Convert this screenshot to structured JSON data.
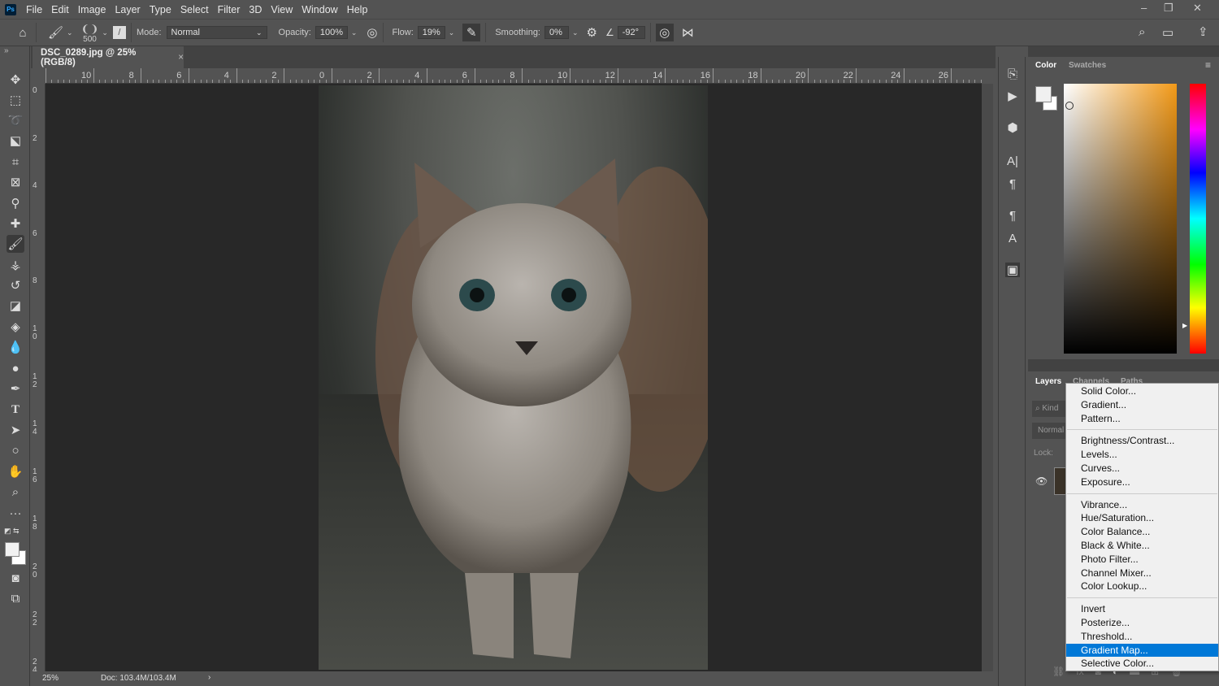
{
  "app": {
    "logo": "Ps"
  },
  "menu": [
    "File",
    "Edit",
    "Image",
    "Layer",
    "Type",
    "Select",
    "Filter",
    "3D",
    "View",
    "Window",
    "Help"
  ],
  "options": {
    "brush_size": "500",
    "mode_label": "Mode:",
    "mode_value": "Normal",
    "opacity_label": "Opacity:",
    "opacity_value": "100%",
    "flow_label": "Flow:",
    "flow_value": "19%",
    "smoothing_label": "Smoothing:",
    "smoothing_value": "0%",
    "angle_value": "-92°"
  },
  "document": {
    "tab_title": "DSC_0289.jpg @ 25% (RGB/8)",
    "close": "×"
  },
  "rulers": {
    "horizontal": [
      "10",
      "8",
      "6",
      "4",
      "2",
      "0",
      "2",
      "4",
      "6",
      "8",
      "10",
      "12",
      "14",
      "16",
      "18",
      "20",
      "22",
      "24",
      "26"
    ],
    "vertical": [
      "0",
      "2",
      "4",
      "6",
      "8",
      "10",
      "12",
      "14",
      "16",
      "18",
      "20",
      "22",
      "24"
    ]
  },
  "status": {
    "zoom": "25%",
    "doc": "Doc: 103.4M/103.4M",
    "arrow": "›"
  },
  "color_panel": {
    "tabs": [
      "Color",
      "Swatches"
    ],
    "hue_top": "#ff0000",
    "selected_hue": "#f39a18"
  },
  "layers_panel": {
    "tabs": [
      "Layers",
      "Channels",
      "Paths"
    ],
    "search": "Kind",
    "blend": "Normal",
    "lock": "Lock:"
  },
  "adjustment_menu": {
    "groups": [
      [
        "Solid Color...",
        "Gradient...",
        "Pattern..."
      ],
      [
        "Brightness/Contrast...",
        "Levels...",
        "Curves...",
        "Exposure..."
      ],
      [
        "Vibrance...",
        "Hue/Saturation...",
        "Color Balance...",
        "Black & White...",
        "Photo Filter...",
        "Channel Mixer...",
        "Color Lookup..."
      ],
      [
        "Invert",
        "Posterize...",
        "Threshold...",
        "Gradient Map...",
        "Selective Color..."
      ]
    ],
    "highlighted": "Gradient Map..."
  }
}
